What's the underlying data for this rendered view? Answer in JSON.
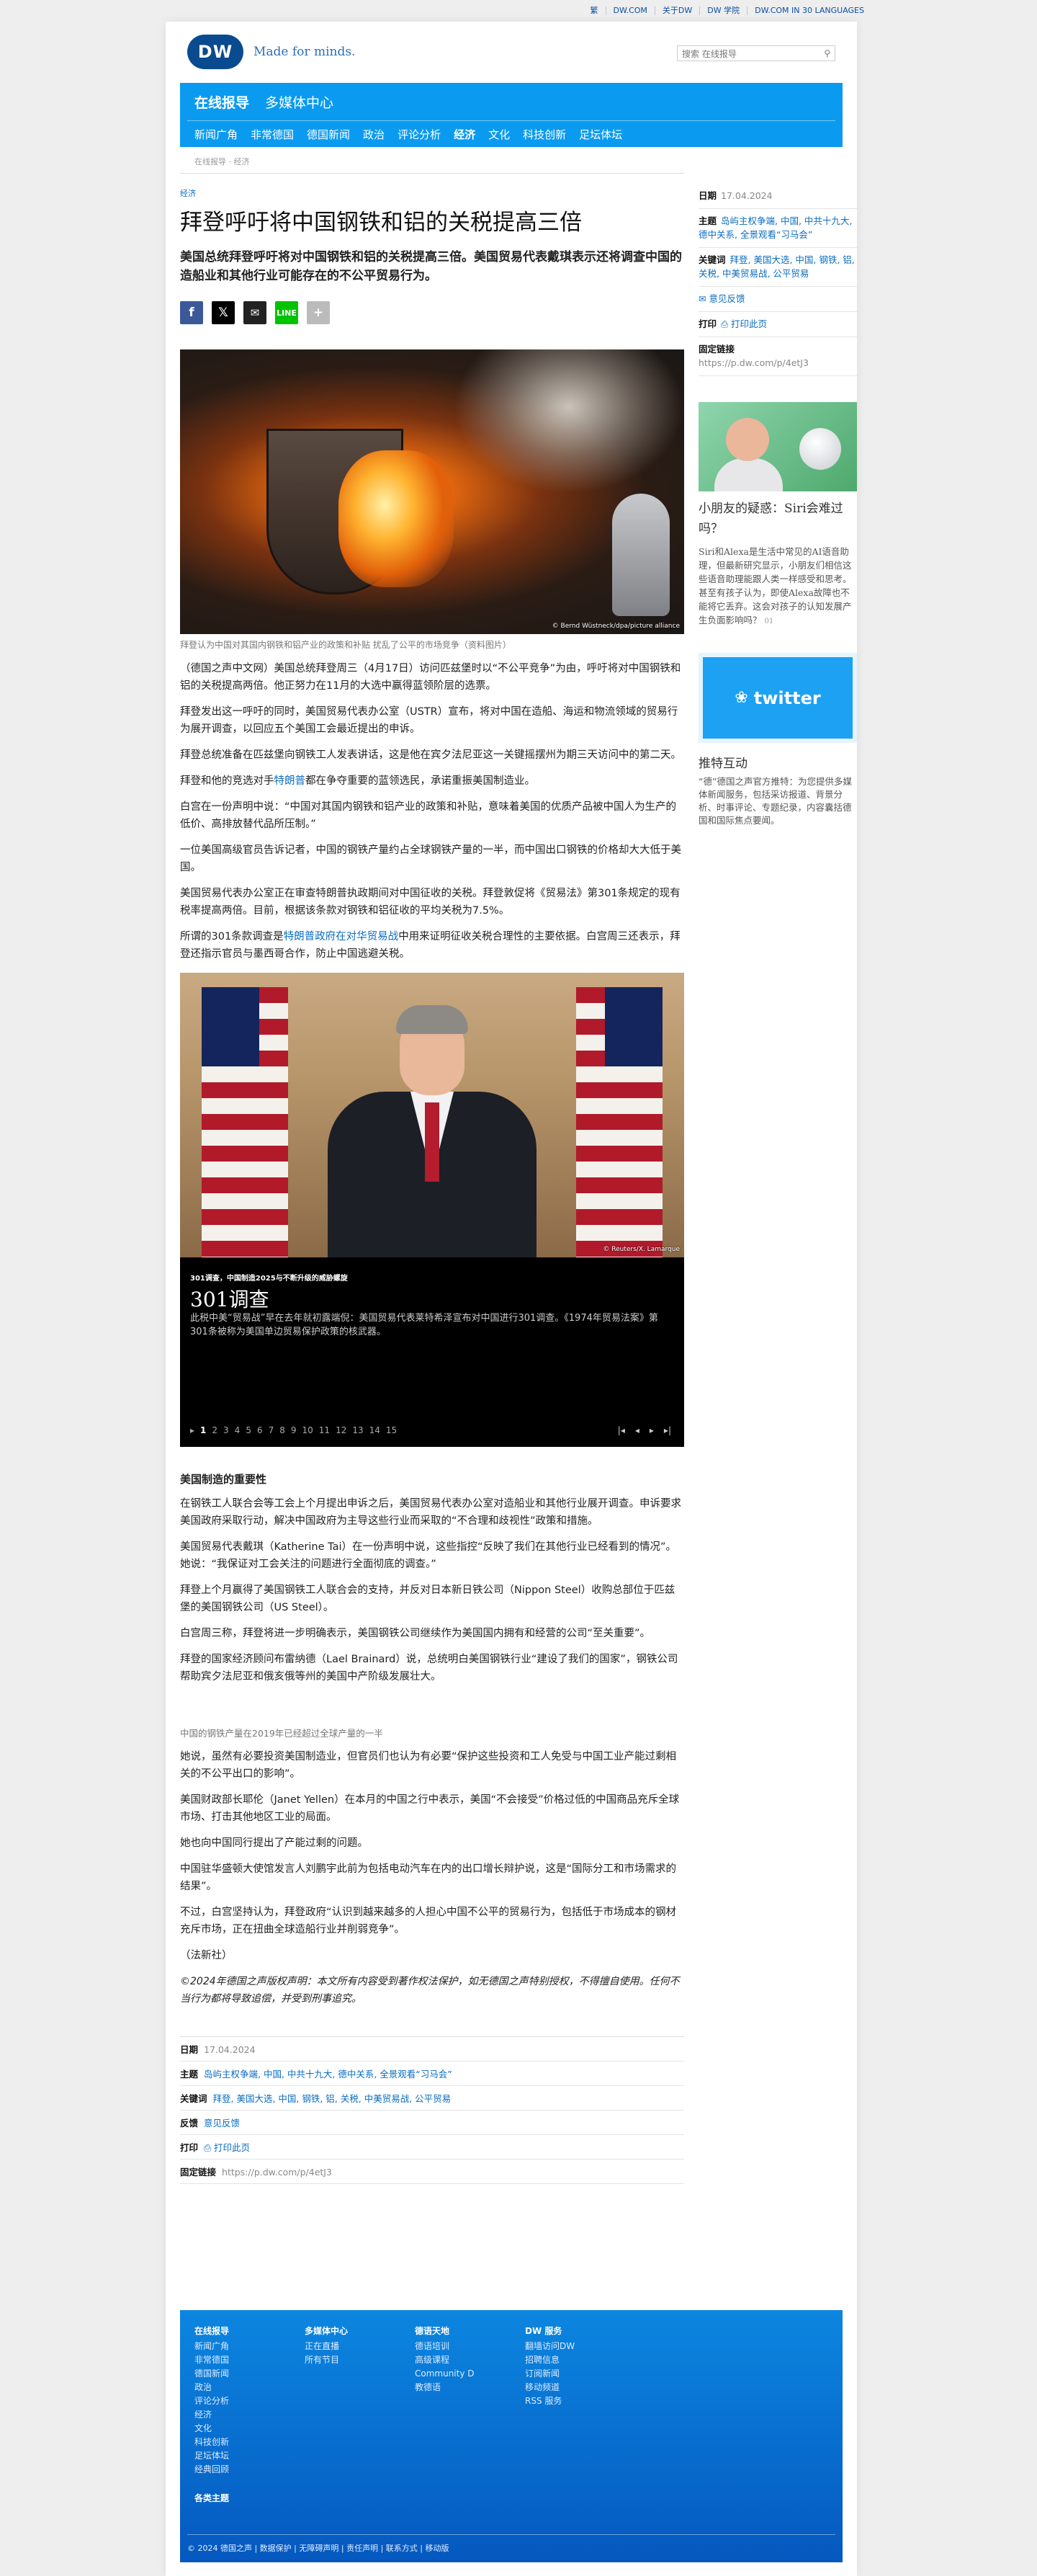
{
  "topbar": {
    "links": [
      "繁",
      "DW.COM",
      "关于DW",
      "DW 学院",
      "DW.COM IN 30 LANGUAGES"
    ]
  },
  "header": {
    "logo": "DW",
    "tagline": "Made for minds.",
    "search_placeholder": "搜索 在线报导"
  },
  "nav": {
    "top": [
      "在线报导",
      "多媒体中心"
    ],
    "sub": [
      "新闻广角",
      "非常德国",
      "德国新闻",
      "政治",
      "评论分析",
      "经济",
      "文化",
      "科技创新",
      "足坛体坛"
    ],
    "active": "经济"
  },
  "breadcrumb": "在线报导 · 经济",
  "article": {
    "kicker": "经济",
    "title": "拜登呼吁将中国钢铁和铝的关税提高三倍",
    "lead": "美国总统拜登呼吁将对中国钢铁和铝的关税提高三倍。美国贸易代表戴琪表示还将调查中国的造船业和其他行业可能存在的不公平贸易行为。",
    "share_icons": [
      "facebook-icon",
      "x-icon",
      "mail-icon",
      "line-icon",
      "plus-icon"
    ],
    "image1_credit": "© Bernd Wüstneck/dpa/picture alliance",
    "image1_caption": "拜登认为中国对其国内钢铁和铝产业的政策和补贴 扰乱了公平的市场竞争（资料图片）",
    "paragraphs1": [
      {
        "text": "（德国之声中文网）美国总统拜登周三（4月17日）访问匹兹堡时以“不公平竞争”为由，呼吁将对中国钢铁和铝的关税提高两倍。他正努力在11月的大选中赢得蓝领阶层的选票。"
      },
      {
        "text": "拜登发出这一呼吁的同时，美国贸易代表办公室（USTR）宣布，将对中国在造船、海运和物流领域的贸易行为展开调查，以回应五个美国工会最近提出的申诉。"
      },
      {
        "text": "拜登总统准备在匹兹堡向钢铁工人发表讲话，这是他在宾夕法尼亚这一关键摇摆州为期三天访问中的第二天。"
      },
      {
        "pre": "拜登和他的竞选对手",
        "link": "特朗普",
        "post": "都在争夺重要的蓝领选民，承诺重振美国制造业。"
      },
      {
        "text": "白宫在一份声明中说：“中国对其国内钢铁和铝产业的政策和补贴，意味着美国的优质产品被中国人为生产的低价、高排放替代品所压制。”"
      },
      {
        "text": "一位美国高级官员告诉记者，中国的钢铁产量约占全球钢铁产量的一半，而中国出口钢铁的价格却大大低于美国。"
      },
      {
        "text": "美国贸易代表办公室正在审查特朗普执政期间对中国征收的关税。拜登敦促将《贸易法》第301条规定的现有税率提高两倍。目前，根据该条款对钢铁和铝征收的平均关税为7.5%。"
      },
      {
        "pre": "所谓的301条款调查是",
        "link": "特朗普政府在对华贸易战",
        "post": "中用来证明征收关税合理性的主要依据。白宫周三还表示，拜登还指示官员与墨西哥合作，防止中国逃避关税。"
      }
    ],
    "gallery": {
      "credit": "© Reuters/X. Lamarque",
      "kicker": "301调查，中国制造2025与不断升级的威胁螺旋",
      "title": "301调查",
      "desc": "此税中美“贸易战”早在去年就初露端倪：美国贸易代表莱特希泽宣布对中国进行301调查。《1974年贸易法案》第301条被称为美国单边贸易保护政策的核武器。",
      "pages": [
        "1",
        "2",
        "3",
        "4",
        "5",
        "6",
        "7",
        "8",
        "9",
        "10",
        "11",
        "12",
        "13",
        "14",
        "15"
      ],
      "current": "1"
    },
    "section2_heading": "美国制造的重要性",
    "paragraphs2": [
      "在钢铁工人联合会等工会上个月提出申诉之后，美国贸易代表办公室对造船业和其他行业展开调查。申诉要求美国政府采取行动，解决中国政府为主导这些行业而采取的“不合理和歧视性”政策和措施。",
      "美国贸易代表戴琪（Katherine Tai）在一份声明中说，这些指控“反映了我们在其他行业已经看到的情况”。\n她说：“我保证对工会关注的问题进行全面彻底的调查。”",
      "拜登上个月赢得了美国钢铁工人联合会的支持，并反对日本新日铁公司（Nippon Steel）收购总部位于匹兹堡的美国钢铁公司（US Steel）。",
      "白宫周三称，拜登将进一步明确表示，美国钢铁公司继续作为美国国内拥有和经营的公司“至关重要”。",
      "拜登的国家经济顾问布雷纳德（Lael Brainard）说，总统明白美国钢铁行业“建设了我们的国家”，钢铁公司帮助宾夕法尼亚和俄亥俄等州的美国中产阶级发展壮大。"
    ],
    "subcaption": "中国的钢铁产量在2019年已经超过全球产量的一半",
    "paragraphs3": [
      "她说，虽然有必要投资美国制造业，但官员们也认为有必要“保护这些投资和工人免受与中国工业产能过剩相关的不公平出口的影响”。",
      "美国财政部长耶伦（Janet Yellen）在本月的中国之行中表示，美国“不会接受”价格过低的中国商品充斥全球市场、打击其他地区工业的局面。",
      "她也向中国同行提出了产能过剩的问题。",
      "中国驻华盛顿大使馆发言人刘鹏宇此前为包括电动汽车在内的出口增长辩护说，这是“国际分工和市场需求的结果”。",
      "不过，白宫坚持认为，拜登政府“认识到越来越多的人担心中国不公平的贸易行为，包括低于市场成本的钢材充斥市场，正在扭曲全球造船行业并削弱竞争”。",
      "（法新社）"
    ],
    "disclaimer": "©2024年德国之声版权声明：本文所有内容受到著作权法保护，如无德国之声特别授权，不得擅自使用。任何不当行为都将导致追偿，并受到刑事追究。",
    "meta": {
      "date_label": "日期",
      "date": "17.04.2024",
      "topic_label": "主题",
      "topics": "岛屿主权争端, 中国, 中共十九大, 德中关系, 全景观看“习马会”",
      "keywords_label": "关键词",
      "keywords": "拜登, 美国大选, 中国, 钢铁, 铝, 关税, 中美贸易战, 公平贸易",
      "feedback_label": "反馈",
      "feedback": "意见反馈",
      "print_label": "打印",
      "print": "打印此页",
      "permalink_label": "固定链接",
      "permalink": "https://p.dw.com/p/4etJ3"
    }
  },
  "sidebar": {
    "date_label": "日期",
    "date": "17.04.2024",
    "topic_label": "主题",
    "topics": "岛屿主权争端, 中国, 中共十九大, 德中关系, 全景观看“习马会”",
    "keywords_label": "关键词",
    "keywords": "拜登, 美国大选, 中国, 钢铁, 铝, 关税, 中美贸易战, 公平贸易",
    "feedback": "意见反馈",
    "print_label": "打印",
    "print": "打印此页",
    "permalink_label": "固定链接",
    "permalink": "https://p.dw.com/p/4etJ3",
    "teaser_title": "小朋友的疑惑：Siri会难过吗？",
    "teaser_text": "Siri和Alexa是生活中常见的AI语音助理，但最新研究显示，小朋友们相信这些语音助理能跟人类一样感受和思考。甚至有孩子认为，即使Alexa故障也不能将它丢弃。这会对孩子的认知发展产生负面影响吗？",
    "teaser_count": "01",
    "twitter_label": "twitter",
    "promo_title": "推特互动",
    "promo_text": "“德”德国之声官方推特：为您提供多媒体新闻服务，包括采访报道、背景分析、时事评论、专题纪录，内容囊括德国和国际焦点要闻。"
  },
  "footer": {
    "cols": [
      {
        "head": "在线报导",
        "items": [
          "新闻广角",
          "非常德国",
          "德国新闻",
          "政治",
          "评论分析",
          "经济",
          "文化",
          "科技创新",
          "足坛体坛",
          "经典回顾"
        ]
      },
      {
        "head": "多媒体中心",
        "items": [
          "正在直播",
          "所有节目"
        ]
      },
      {
        "head": "德语天地",
        "items": [
          "德语培训",
          "高级课程",
          "Community D",
          "教德语"
        ]
      },
      {
        "head": "DW 服务",
        "items": [
          "翻墙访问DW",
          "招聘信息",
          "订阅新闻",
          "移动频道",
          "RSS 服务"
        ]
      }
    ],
    "main_topics": "各类主题",
    "copyright": "© 2024 德国之声 | 数据保护 | 无障碍声明 | 责任声明 | 联系方式 | 移动版"
  }
}
